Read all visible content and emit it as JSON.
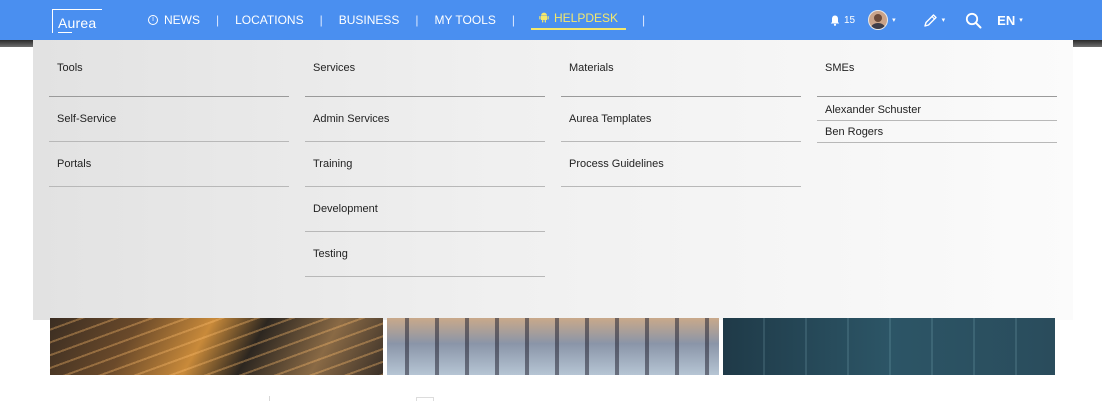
{
  "brand": {
    "logo_text": "Aurea"
  },
  "nav": {
    "items": [
      {
        "label": "NEWS"
      },
      {
        "label": "LOCATIONS"
      },
      {
        "label": "BUSINESS"
      },
      {
        "label": "MY TOOLS"
      },
      {
        "label": "HELPDESK",
        "active": true
      }
    ],
    "separator": "|"
  },
  "toolbar": {
    "notification_count": "15",
    "language": "EN"
  },
  "menu": {
    "columns": [
      {
        "heading": "Tools",
        "items": [
          "Self-Service",
          "Portals"
        ]
      },
      {
        "heading": "Services",
        "items": [
          "Admin Services",
          "Training",
          "Development",
          "Testing"
        ]
      },
      {
        "heading": "Materials",
        "items": [
          "Aurea Templates",
          "Process Guidelines"
        ]
      },
      {
        "heading": "SMEs",
        "items": [
          "Alexander Schuster",
          "Ben Rogers"
        ]
      }
    ]
  },
  "colors": {
    "topbar": "#4a8ff0",
    "active_nav": "#f4e86b"
  }
}
